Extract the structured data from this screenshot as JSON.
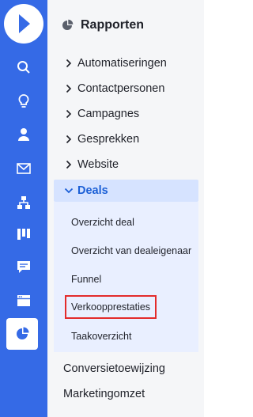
{
  "rail": {
    "items": [
      {
        "icon": "search-icon"
      },
      {
        "icon": "lightbulb-icon"
      },
      {
        "icon": "person-icon"
      },
      {
        "icon": "envelope-icon"
      },
      {
        "icon": "sitemap-icon"
      },
      {
        "icon": "kanban-icon"
      },
      {
        "icon": "chat-icon"
      },
      {
        "icon": "browser-window-icon"
      },
      {
        "icon": "pie-chart-icon",
        "active": true
      }
    ]
  },
  "panel": {
    "title": "Rapporten",
    "items": [
      {
        "label": "Automatiseringen"
      },
      {
        "label": "Contactpersonen"
      },
      {
        "label": "Campagnes"
      },
      {
        "label": "Gesprekken"
      },
      {
        "label": "Website"
      },
      {
        "label": "Deals",
        "expanded": true
      }
    ],
    "sub_items": [
      {
        "label": "Overzicht deal"
      },
      {
        "label": "Overzicht van dealeigenaar"
      },
      {
        "label": "Funnel"
      },
      {
        "label": "Verkoopprestaties",
        "highlighted": true
      },
      {
        "label": "Taakoverzicht"
      }
    ],
    "footer_items": [
      {
        "label": "Conversietoewijzing"
      },
      {
        "label": "Marketingomzet"
      }
    ]
  },
  "colors": {
    "rail": "#356ae6",
    "panel": "#f5f6f8",
    "expanded_bg": "#d6e3ff",
    "accent": "#1b5fd6",
    "sub_bg": "#e9efff",
    "highlight_border": "#e32b2b"
  }
}
